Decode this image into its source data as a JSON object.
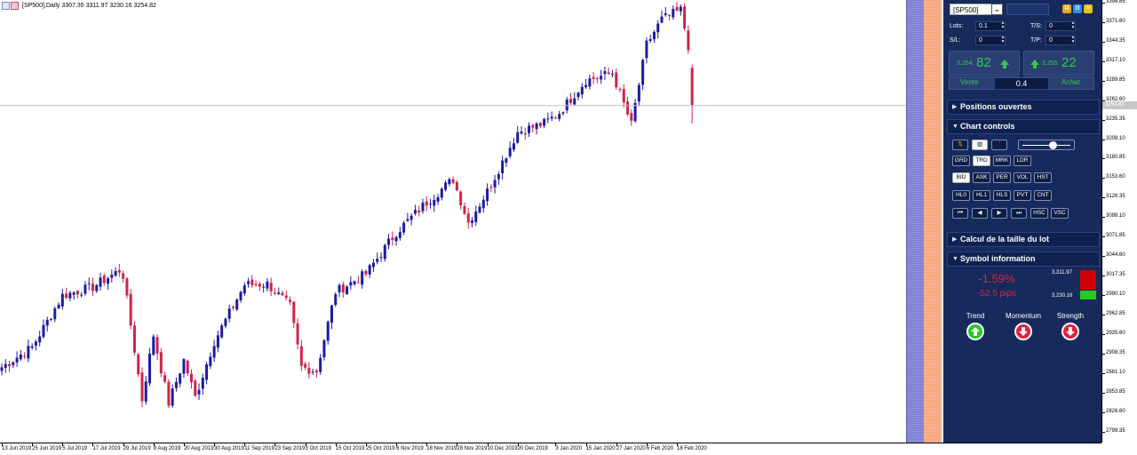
{
  "header": {
    "text": "[SP500],Daily  3307.35 3311.97 3230.16 3254.82"
  },
  "chart_data": {
    "type": "candlestick",
    "symbol": "[SP500]",
    "timeframe": "Daily",
    "ohlc_last": {
      "open": 3307.35,
      "high": 3311.97,
      "low": 3230.16,
      "close": 3254.82
    },
    "current_price": 3254.82,
    "ylim": [
      2785,
      3402
    ],
    "grid": false,
    "colors": {
      "bull": "#1c1c9f",
      "bear": "#d0234a",
      "background": "#ffffff"
    },
    "y_ticks": [
      "3398.85",
      "3371.60",
      "3344.35",
      "3317.10",
      "3289.85",
      "3262.60",
      "3235.35",
      "3208.10",
      "3180.85",
      "3153.60",
      "3126.35",
      "3099.10",
      "3071.85",
      "3044.60",
      "3017.35",
      "2990.10",
      "2962.85",
      "2935.60",
      "2908.35",
      "2881.10",
      "2853.85",
      "2826.60",
      "2799.35"
    ],
    "x_ticks": [
      "13 Jun 2019",
      "25 Jun 2019",
      "5 Jul 2019",
      "17 Jul 2019",
      "29 Jul 2019",
      "8 Aug 2019",
      "20 Aug 2019",
      "30 Aug 2019",
      "11 Sep 2019",
      "23 Sep 2019",
      "3 Oct 2019",
      "15 Oct 2019",
      "25 Oct 2019",
      "6 Nov 2019",
      "18 Nov 2019",
      "28 Nov 2019",
      "10 Dec 2019",
      "20 Dec 2019",
      "3 Jan 2020",
      "15 Jan 2020",
      "27 Jan 2020",
      "6 Feb 2020",
      "18 Feb 2020"
    ],
    "anchors": [
      {
        "d": "13 Jun 2019",
        "c": 2890
      },
      {
        "d": "25 Jun 2019",
        "c": 2918
      },
      {
        "d": "5 Jul 2019",
        "c": 2990
      },
      {
        "d": "17 Jul 2019",
        "c": 3002
      },
      {
        "d": "26 Jul 2019",
        "c": 3025
      },
      {
        "d": "29 Jul 2019",
        "c": 3018
      },
      {
        "d": "5 Aug 2019",
        "c": 2845
      },
      {
        "d": "8 Aug 2019",
        "c": 2935
      },
      {
        "d": "14 Aug 2019",
        "c": 2840
      },
      {
        "d": "20 Aug 2019",
        "c": 2900
      },
      {
        "d": "23 Aug 2019",
        "c": 2848
      },
      {
        "d": "30 Aug 2019",
        "c": 2926
      },
      {
        "d": "11 Sep 2019",
        "c": 3005
      },
      {
        "d": "19 Sep 2019",
        "c": 3006
      },
      {
        "d": "27 Sep 2019",
        "c": 2975
      },
      {
        "d": "2 Oct 2019",
        "c": 2890
      },
      {
        "d": "8 Oct 2019",
        "c": 2885
      },
      {
        "d": "15 Oct 2019",
        "c": 2995
      },
      {
        "d": "25 Oct 2019",
        "c": 3020
      },
      {
        "d": "6 Nov 2019",
        "c": 3078
      },
      {
        "d": "18 Nov 2019",
        "c": 3120
      },
      {
        "d": "27 Nov 2019",
        "c": 3152
      },
      {
        "d": "3 Dec 2019",
        "c": 3092
      },
      {
        "d": "10 Dec 2019",
        "c": 3135
      },
      {
        "d": "20 Dec 2019",
        "c": 3218
      },
      {
        "d": "31 Dec 2019",
        "c": 3230
      },
      {
        "d": "6 Jan 2020",
        "c": 3245
      },
      {
        "d": "15 Jan 2020",
        "c": 3290
      },
      {
        "d": "24 Jan 2020",
        "c": 3300
      },
      {
        "d": "31 Jan 2020",
        "c": 3228
      },
      {
        "d": "6 Feb 2020",
        "c": 3340
      },
      {
        "d": "12 Feb 2020",
        "c": 3375
      },
      {
        "d": "19 Feb 2020",
        "c": 3388
      },
      {
        "d": "21 Feb 2020",
        "c": 3338
      },
      {
        "d": "24 Feb 2020",
        "c": 3254
      }
    ]
  },
  "panel": {
    "symbol": "[SP500]",
    "lots_label": "Lots:",
    "lots_value": "0.1",
    "sl_label": "S/L:",
    "sl_value": "0",
    "ts_label": "T/S:",
    "ts_value": "0",
    "tp_label": "T/P:",
    "tp_value": "0",
    "sell_price_small": "3,254.",
    "sell_price_big": "82",
    "buy_price_small": "3,255.",
    "buy_price_big": "22",
    "sell_label": "Vente",
    "buy_label": "Achat",
    "spread": "0.4",
    "sections": {
      "positions": "Positions ouvertes",
      "chart_controls": "Chart controls",
      "lot_calc": "Calcul de la taille du lot",
      "symbol_info": "Symbol information"
    },
    "controls_row1": [
      "GRD",
      "TRD",
      "MRK",
      "LDR"
    ],
    "controls_row2": [
      "BID",
      "ASK",
      "PER",
      "VOL",
      "HST"
    ],
    "controls_row3": [
      "HL0",
      "HL1",
      "HLS",
      "PVT",
      "CNT"
    ],
    "controls_row4": [
      "HSC",
      "VSC"
    ],
    "symbol_info": {
      "change_pct": "-1.59%",
      "change_pips": "-52.5 pips",
      "high": "3,311.97",
      "low": "3,230.16",
      "high_color": "#cc0000",
      "low_color": "#22cc22"
    },
    "indicators": [
      {
        "label": "Trend",
        "direction": "up",
        "color": "#22cc22"
      },
      {
        "label": "Momentum",
        "direction": "down",
        "color": "#e0213b"
      },
      {
        "label": "Strength",
        "direction": "down",
        "color": "#e0213b"
      }
    ]
  }
}
